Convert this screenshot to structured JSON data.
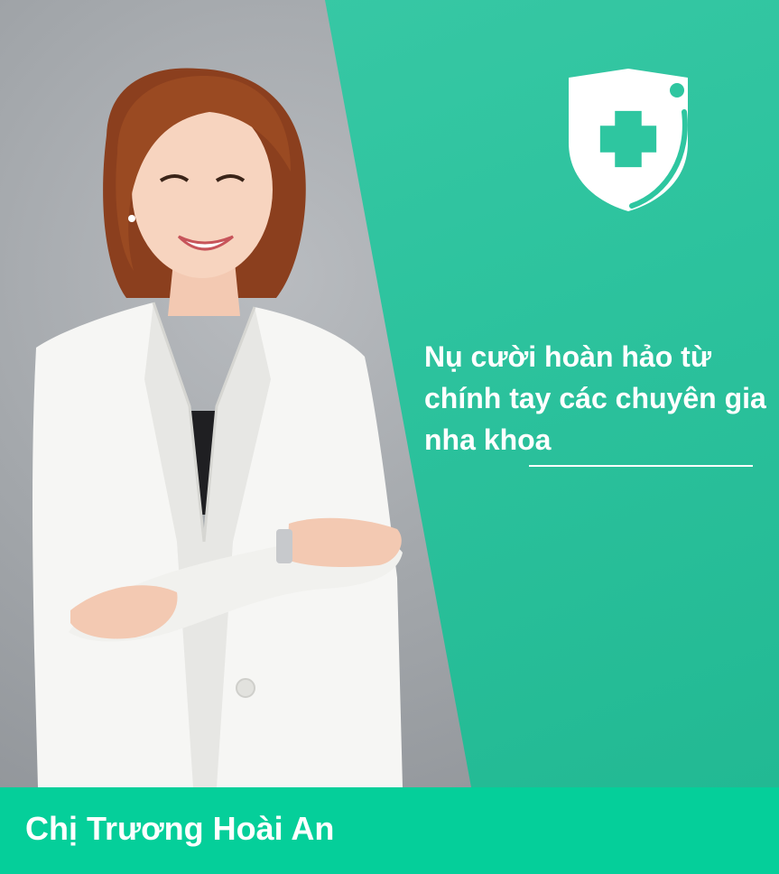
{
  "headline": {
    "text": "Nụ cười hoàn hảo từ chính tay các chuyên gia nha khoa"
  },
  "footer": {
    "name": "Chị Trương Hoài An"
  },
  "logo": {
    "icon": "medical-shield-plus-icon"
  },
  "photo": {
    "icon": "doctor-portrait"
  },
  "colors": {
    "teal_panel": "#2dc39e",
    "footer_bar": "#05cf9a",
    "text": "#ffffff",
    "logo_cross": "#2ec6a0"
  }
}
